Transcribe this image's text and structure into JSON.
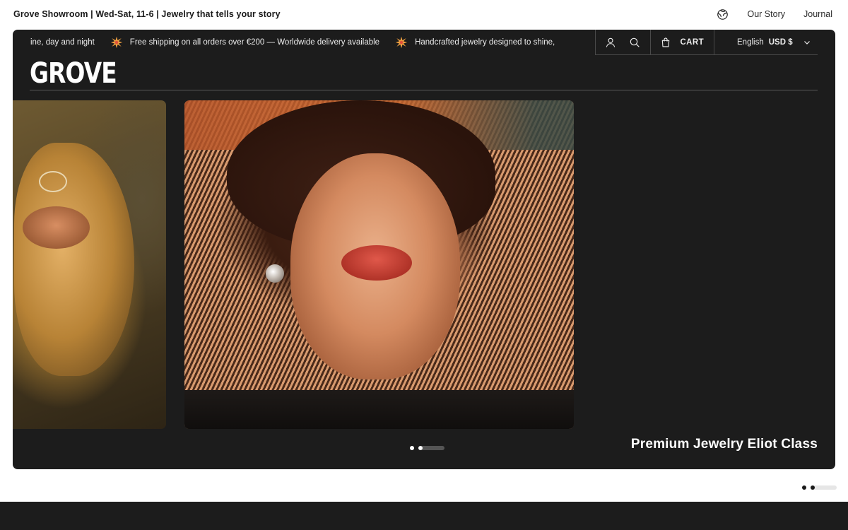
{
  "topbar": {
    "info": "Grove Showroom | Wed-Sat, 11-6 | Jewelry that tells your story",
    "links": [
      "Our Story",
      "Journal"
    ],
    "globe_icon": "globe-icon"
  },
  "announcement": {
    "items": [
      "ine, day and night",
      "Free shipping on all orders over €200 — Worldwide delivery available",
      "Handcrafted jewelry designed to shine,"
    ],
    "separator_icon": "burst-icon",
    "separator_color": "#f0a040"
  },
  "header": {
    "account_icon": "user-icon",
    "search_icon": "search-icon",
    "cart_icon": "shopping-bag-icon",
    "cart_label": "CART",
    "language": "English",
    "currency": "USD $",
    "chevron_icon": "chevron-down-icon"
  },
  "brand": {
    "logo": "GROVE"
  },
  "hero": {
    "caption": "Premium Jewelry Eliot Class",
    "slide_count": 2,
    "active_slide": 2
  },
  "page_slider": {
    "active_dot": 2
  },
  "colors": {
    "panel_bg": "#1c1c1c",
    "text_light": "#ececec",
    "accent": "#f0a040"
  }
}
